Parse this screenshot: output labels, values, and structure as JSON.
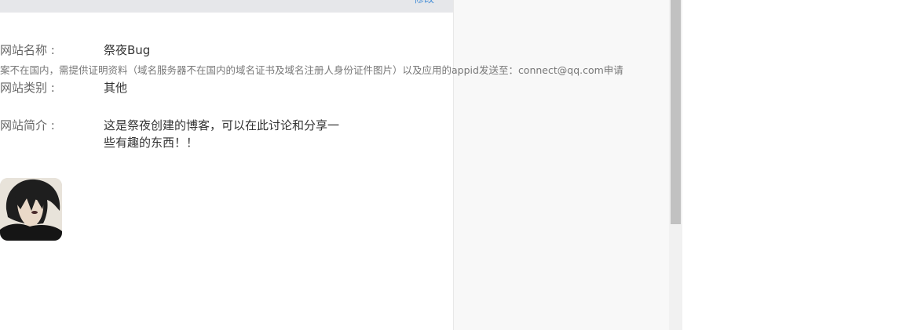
{
  "header": {
    "link_label": "修改"
  },
  "form": {
    "site_name_label": "网站名称 :",
    "site_name_value": "祭夜Bug",
    "notice": "案不在国内，需提供证明资料（域名服务器不在国内的域名证书及域名注册人身份证件图片）以及应用的appid发送至：connect@qq.com申请",
    "category_label": "网站类别 :",
    "category_value": "其他",
    "intro_label": "网站简介 :",
    "intro_value_line1": "这是祭夜创建的博客，可以在此讨论和分享一",
    "intro_value_line2": "些有趣的东西！！"
  },
  "avatar": {
    "icon": "site-logo-anime-character"
  }
}
